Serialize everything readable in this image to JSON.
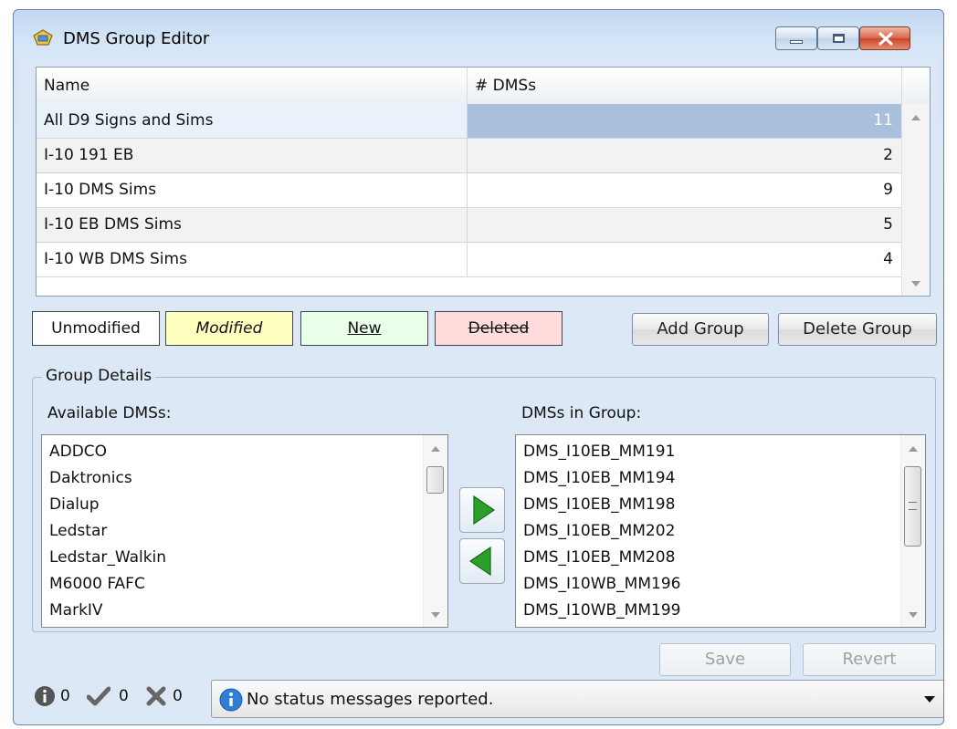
{
  "window": {
    "title": "DMS Group Editor"
  },
  "grid": {
    "columns": [
      "Name",
      "# DMSs"
    ],
    "rows": [
      {
        "name": "All D9 Signs and Sims",
        "count": "11"
      },
      {
        "name": "I-10 191 EB",
        "count": "2"
      },
      {
        "name": "I-10 DMS Sims",
        "count": "9"
      },
      {
        "name": "I-10 EB DMS Sims",
        "count": "5"
      },
      {
        "name": "I-10 WB DMS Sims",
        "count": "4"
      }
    ]
  },
  "legend": {
    "unmodified": "Unmodified",
    "modified": "Modified",
    "new": "New",
    "deleted": "Deleted"
  },
  "buttons": {
    "add_group": "Add Group",
    "delete_group": "Delete Group",
    "save": "Save",
    "revert": "Revert"
  },
  "group_details": {
    "title": "Group Details",
    "available_label": "Available DMSs:",
    "in_group_label": "DMSs in Group:",
    "available": [
      "ADDCO",
      "Daktronics",
      "Dialup",
      "Ledstar",
      "Ledstar_Walkin",
      "M6000 FAFC",
      "MarkIV"
    ],
    "in_group": [
      "DMS_I10EB_MM191",
      "DMS_I10EB_MM194",
      "DMS_I10EB_MM198",
      "DMS_I10EB_MM202",
      "DMS_I10EB_MM208",
      "DMS_I10WB_MM196",
      "DMS_I10WB_MM199"
    ]
  },
  "status": {
    "info_count": "0",
    "ok_count": "0",
    "error_count": "0",
    "message": "No status messages reported."
  },
  "colors": {
    "modified_bg": "#ffffc0",
    "new_bg": "#eaffea",
    "deleted_bg": "#ffdcdc",
    "selected_cell": "#a9bfdc",
    "arrow_green": "#2aa02a"
  },
  "icons": {
    "add_arrow": "arrow-right-icon",
    "remove_arrow": "arrow-left-icon",
    "info": "info-icon",
    "check": "check-icon",
    "error": "x-icon"
  }
}
